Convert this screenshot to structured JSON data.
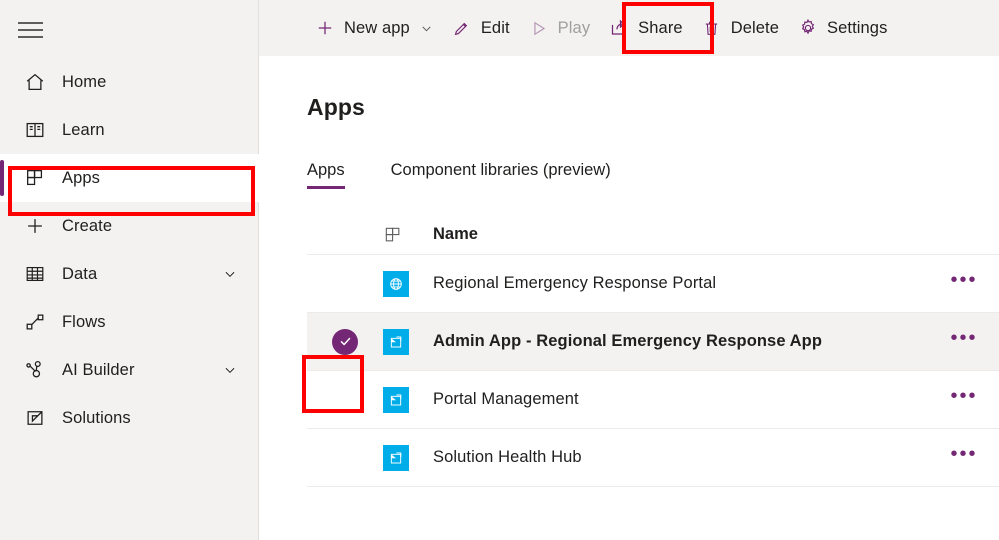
{
  "sidebar": {
    "menu_icon": "hamburger-icon",
    "items": [
      {
        "label": "Home",
        "icon": "home-icon",
        "selected": false,
        "chevron": false
      },
      {
        "label": "Learn",
        "icon": "book-icon",
        "selected": false,
        "chevron": false
      },
      {
        "label": "Apps",
        "icon": "apps-grid-icon",
        "selected": true,
        "chevron": false
      },
      {
        "label": "Create",
        "icon": "plus-icon",
        "selected": false,
        "chevron": false
      },
      {
        "label": "Data",
        "icon": "table-icon",
        "selected": false,
        "chevron": true
      },
      {
        "label": "Flows",
        "icon": "flow-icon",
        "selected": false,
        "chevron": false
      },
      {
        "label": "AI Builder",
        "icon": "ai-builder-icon",
        "selected": false,
        "chevron": true
      },
      {
        "label": "Solutions",
        "icon": "solutions-icon",
        "selected": false,
        "chevron": false
      }
    ]
  },
  "toolbar": {
    "buttons": [
      {
        "label": "New app",
        "icon": "plus-icon",
        "caret": true,
        "disabled": false,
        "highlighted": false
      },
      {
        "label": "Edit",
        "icon": "pencil-icon",
        "caret": false,
        "disabled": false,
        "highlighted": false
      },
      {
        "label": "Play",
        "icon": "play-icon",
        "caret": false,
        "disabled": true,
        "highlighted": false
      },
      {
        "label": "Share",
        "icon": "share-icon",
        "caret": false,
        "disabled": false,
        "highlighted": true
      },
      {
        "label": "Delete",
        "icon": "trash-icon",
        "caret": false,
        "disabled": false,
        "highlighted": false
      },
      {
        "label": "Settings",
        "icon": "gear-icon",
        "caret": false,
        "disabled": false,
        "highlighted": false
      }
    ]
  },
  "main": {
    "page_title": "Apps",
    "tabs": [
      {
        "label": "Apps",
        "active": true
      },
      {
        "label": "Component libraries (preview)",
        "active": false
      }
    ],
    "table": {
      "header_icon": "apps-grid-icon",
      "columns": [
        "Name"
      ],
      "rows": [
        {
          "name": "Regional Emergency Response Portal",
          "icon": "globe-app-icon",
          "selected": false,
          "more": "•••"
        },
        {
          "name": "Admin App - Regional Emergency Response App",
          "icon": "model-driven-app-icon",
          "selected": true,
          "more": "•••"
        },
        {
          "name": "Portal Management",
          "icon": "model-driven-app-icon",
          "selected": false,
          "more": "•••"
        },
        {
          "name": "Solution Health Hub",
          "icon": "model-driven-app-icon",
          "selected": false,
          "more": "•••"
        }
      ]
    }
  },
  "annotations": {
    "boxes": [
      {
        "name": "share-button-highlight",
        "color": "#ff0000"
      },
      {
        "name": "apps-nav-highlight",
        "color": "#ff0000"
      },
      {
        "name": "row-checkbox-highlight",
        "color": "#ff0000"
      }
    ]
  },
  "colors": {
    "accent_purple": "#742774",
    "app_tile_blue": "#00ade8",
    "chrome_gray": "#f3f2f1",
    "annotation_red": "#ff0000"
  }
}
